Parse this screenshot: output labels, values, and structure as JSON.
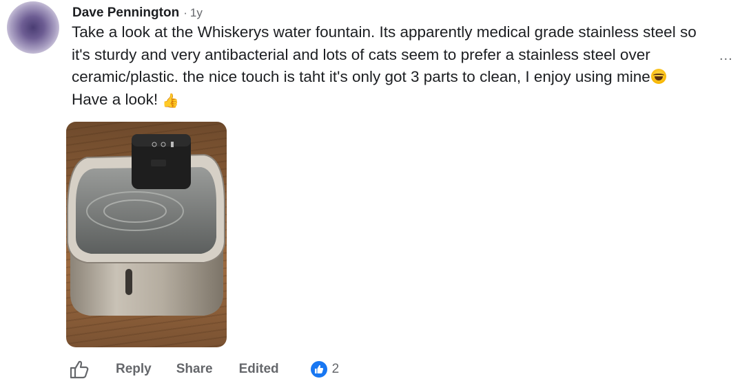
{
  "comment": {
    "author": "Dave Pennington",
    "separator": "·",
    "time": "1y",
    "text_part1": "Take a look at the Whiskerys water fountain. Its apparently medical grade stainless steel so it's sturdy and very antibacterial and lots of cats seem to prefer a stainless steel over ceramic/plastic. the nice touch is taht it's only got 3 parts to clean, I enjoy using mine",
    "text_part2": "Have a look!",
    "emoji_1": "laughing-emoji",
    "emoji_2": "thumbs-up-emoji"
  },
  "more_menu": "...",
  "actions": {
    "like_icon": "thumbs-up-outline-icon",
    "reply_label": "Reply",
    "share_label": "Share",
    "edited_label": "Edited",
    "reaction_icon": "like-reaction-icon",
    "reaction_count": "2"
  },
  "colors": {
    "accent": "#1877f2",
    "secondary_text": "#65676b",
    "primary_text": "#1c1e21"
  }
}
